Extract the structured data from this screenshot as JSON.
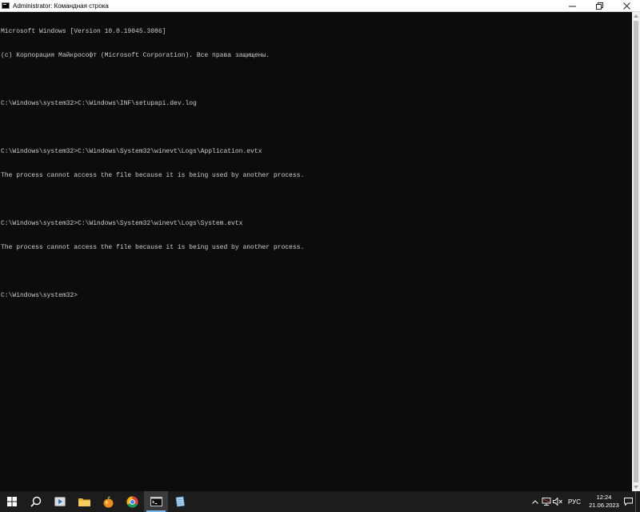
{
  "window": {
    "title": "Administrator: Командная строка",
    "controls": {
      "minimize": "—",
      "restore": "❐",
      "close": "✕"
    }
  },
  "console": {
    "lines": [
      "Microsoft Windows [Version 10.0.19045.3086]",
      "(c) Корпорация Майкрософт (Microsoft Corporation). Все права защищены.",
      "",
      "C:\\Windows\\system32>C:\\Windows\\INF\\setupapi.dev.log",
      "",
      "C:\\Windows\\system32>C:\\Windows\\System32\\winevt\\Logs\\Application.evtx",
      "The process cannot access the file because it is being used by another process.",
      "",
      "C:\\Windows\\system32>C:\\Windows\\System32\\winevt\\Logs\\System.evtx",
      "The process cannot access the file because it is being used by another process.",
      "",
      "C:\\Windows\\system32>"
    ]
  },
  "taskbar": {
    "items": [
      {
        "name": "start-button",
        "icon": "windows-logo-icon"
      },
      {
        "name": "search-button",
        "icon": "search-icon"
      },
      {
        "name": "taskbar-media-player",
        "icon": "media-player-icon"
      },
      {
        "name": "taskbar-file-explorer",
        "icon": "folder-icon"
      },
      {
        "name": "taskbar-fl-studio",
        "icon": "fruit-icon"
      },
      {
        "name": "taskbar-chrome",
        "icon": "chrome-icon"
      },
      {
        "name": "taskbar-cmd",
        "icon": "terminal-icon",
        "active": true
      },
      {
        "name": "taskbar-notepad",
        "icon": "notepad-icon"
      }
    ],
    "tray": {
      "language": "РУС",
      "time": "12:24",
      "date": "21.06.2023"
    }
  },
  "colors": {
    "console_bg": "#0c0c0c",
    "console_fg": "#cccccc",
    "taskbar_bg": "#1c1c1c",
    "accent": "#76b9ed"
  }
}
